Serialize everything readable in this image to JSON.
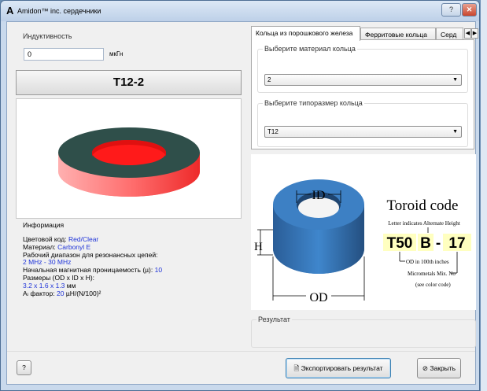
{
  "window": {
    "title": "Amidon™ inc. сердечники",
    "help_label": "?",
    "close_label": "✕"
  },
  "inductance": {
    "label": "Индуктивность",
    "value": "0",
    "unit": "мкГн"
  },
  "core_name": "T12-2",
  "info": {
    "title": "Информация",
    "color_label": "Цветовой код:",
    "color_value": "Red/Clear",
    "material_label": "Материал:",
    "material_value": "Carbonyl E",
    "range_label": "Рабочий диапазон для резонансных цепей:",
    "range_value": "2 MHz - 30 MHz",
    "perm_label": "Начальная магнитная проницаемость (µ):",
    "perm_value": "10",
    "size_label": "Размеры (OD x ID x H):",
    "size_value": "3.2 x 1.6 x 1.3",
    "size_unit": "мм",
    "al_label": "Aₗ фактор:",
    "al_value": "20",
    "al_unit": "µH/(N/100)²"
  },
  "tabs": [
    {
      "label": "Кольца из порошкового железа"
    },
    {
      "label": "Ферритовые кольца"
    },
    {
      "label": "Серд"
    }
  ],
  "material_select": {
    "label": "Выберите материал кольца",
    "value": "2"
  },
  "size_select": {
    "label": "Выберите типоразмер кольца",
    "value": "T12"
  },
  "diagram": {
    "id_label": "ID",
    "od_label": "OD",
    "h_label": "H",
    "title": "Toroid code",
    "alt_height_note": "Letter indicates Alternate Height",
    "code_t": "T50",
    "code_b": "B",
    "code_dash": "-",
    "code_17": "17",
    "od_note": "OD in 100th inches",
    "mix_note": "Micrometals Mix. No",
    "color_note": "(see color code)"
  },
  "result": {
    "label": "Результат"
  },
  "buttons": {
    "help": "?",
    "export": "Экспортировать результат",
    "close": "Закрыть"
  },
  "colors": {
    "toroid_top": "#2f4f4a",
    "toroid_side": "#ff6b6b",
    "toroid_inner": "#ff1a1a",
    "blue_core": "#2f6fb0",
    "code_highlight": "#ffffc0"
  }
}
